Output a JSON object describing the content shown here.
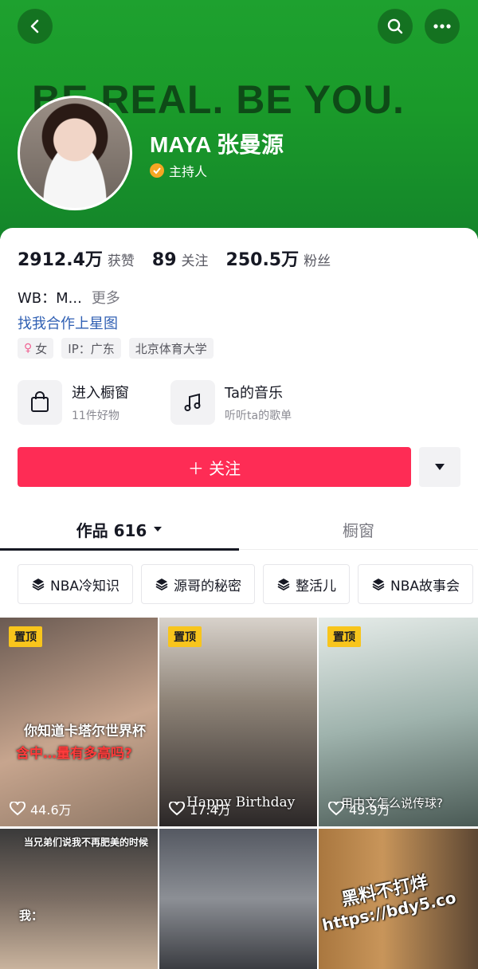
{
  "header": {
    "slogan": "BE REAL. BE YOU.",
    "back_icon": "chevron-left-icon",
    "search_icon": "search-icon",
    "more_icon": "more-dots-icon"
  },
  "profile": {
    "name": "MAYA 张曼源",
    "role": "主持人",
    "stats": [
      {
        "value": "2912.4万",
        "label": "获赞"
      },
      {
        "value": "89",
        "label": "关注"
      },
      {
        "value": "250.5万",
        "label": "粉丝"
      }
    ],
    "bio": "WB：M...",
    "bio_more": "更多",
    "coop_link": "找我合作上星图",
    "tags": {
      "gender": "女",
      "ip": "IP：广东",
      "school": "北京体育大学"
    }
  },
  "shortcuts": [
    {
      "title": "进入橱窗",
      "subtitle": "11件好物",
      "icon": "shopping-bag-icon"
    },
    {
      "title": "Ta的音乐",
      "subtitle": "听听ta的歌单",
      "icon": "music-note-icon"
    }
  ],
  "actions": {
    "follow": "＋ 关注",
    "dropdown_icon": "caret-down-icon"
  },
  "tabs": {
    "works": "作品 616",
    "window": "橱窗"
  },
  "collections": [
    "NBA冷知识",
    "源哥的秘密",
    "整活儿",
    "NBA故事会"
  ],
  "videos": [
    {
      "pinned": "置顶",
      "likes": "44.6万",
      "caption1": "你知道卡塔尔世界杯",
      "caption2": "含中…量有多高吗?"
    },
    {
      "pinned": "置顶",
      "likes": "17.4万",
      "caption1": "Happy Birthday"
    },
    {
      "pinned": "置顶",
      "likes": "49.9万",
      "caption1": "用中文怎么说传球?"
    },
    {
      "caption1": "当兄弟们说我不再肥美的时候",
      "caption2": "我："
    },
    {},
    {}
  ],
  "watermark": {
    "line1": "黑料不打烊",
    "line2": "https://bdy5.co"
  },
  "colors": {
    "banner_green": "#1ea12f",
    "follow_red": "#fe2c55",
    "pin_yellow": "#f8c51c",
    "link_blue": "#2f5fb3"
  }
}
